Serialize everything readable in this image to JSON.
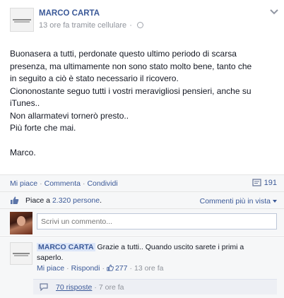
{
  "post": {
    "author": "MARCO CARTA",
    "time": "13 ore fa",
    "via": "tramite cellulare",
    "body": "Buonasera a tutti, perdonate questo ultimo periodo di scarsa\npresenza, ma ultimamente non sono stato molto bene, tanto che\nin seguito a ciò è stato necessario il ricovero.\nCiononostante seguo tutti i vostri meravigliosi pensieri, anche su\niTunes..\nNon allarmatevi tornerò presto..\nPiù forte che mai.\n\nMarco."
  },
  "actions": {
    "like": "Mi piace",
    "comment": "Commenta",
    "share": "Condividi",
    "share_count": "191"
  },
  "likes": {
    "prefix": "Piace a",
    "count": "2.320 persone",
    "suffix": ".",
    "sort_label": "Commenti più in vista"
  },
  "comment_input": {
    "placeholder": "Scrivi un commento..."
  },
  "reply": {
    "author": "MARCO CARTA",
    "text": "Grazie a tutti.. Quando uscito sarete i primi a saperlo.",
    "like": "Mi piace",
    "reply": "Rispondi",
    "like_count": "277",
    "time": "13 ore fa",
    "replies_count": "70 risposte",
    "replies_time": "7 ore fa"
  },
  "colors": {
    "link": "#3b5998",
    "meta": "#90949c",
    "panel_bg": "#f6f7f8"
  }
}
